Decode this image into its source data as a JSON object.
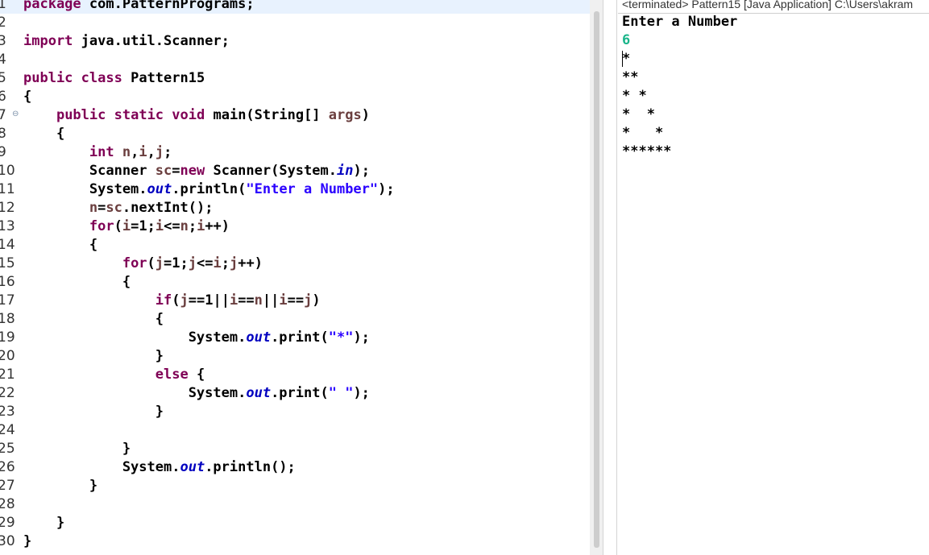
{
  "editor": {
    "lines": [
      {
        "num": "1",
        "tokens": [
          {
            "t": "package",
            "c": "kw"
          },
          {
            "t": " com.PatternPrograms;",
            "c": "pn"
          }
        ]
      },
      {
        "num": "2",
        "tokens": []
      },
      {
        "num": "3",
        "tokens": [
          {
            "t": "import",
            "c": "kw"
          },
          {
            "t": " java.util.Scanner;",
            "c": "pn"
          }
        ]
      },
      {
        "num": "4",
        "tokens": []
      },
      {
        "num": "5",
        "tokens": [
          {
            "t": "public",
            "c": "kw"
          },
          {
            "t": " ",
            "c": "pn"
          },
          {
            "t": "class",
            "c": "kw"
          },
          {
            "t": " Pattern15",
            "c": "pn"
          }
        ]
      },
      {
        "num": "6",
        "tokens": [
          {
            "t": "{",
            "c": "pn"
          }
        ]
      },
      {
        "num": "7",
        "fold": "⊖",
        "tokens": [
          {
            "t": "    ",
            "c": "pn"
          },
          {
            "t": "public",
            "c": "kw"
          },
          {
            "t": " ",
            "c": "pn"
          },
          {
            "t": "static",
            "c": "kw"
          },
          {
            "t": " ",
            "c": "pn"
          },
          {
            "t": "void",
            "c": "kw"
          },
          {
            "t": " main(String[] ",
            "c": "pn"
          },
          {
            "t": "args",
            "c": "var"
          },
          {
            "t": ")",
            "c": "pn"
          }
        ]
      },
      {
        "num": "8",
        "tokens": [
          {
            "t": "    {",
            "c": "pn"
          }
        ]
      },
      {
        "num": "9",
        "tokens": [
          {
            "t": "        ",
            "c": "pn"
          },
          {
            "t": "int",
            "c": "kw"
          },
          {
            "t": " ",
            "c": "pn"
          },
          {
            "t": "n",
            "c": "var"
          },
          {
            "t": ",",
            "c": "pn"
          },
          {
            "t": "i",
            "c": "var"
          },
          {
            "t": ",",
            "c": "pn"
          },
          {
            "t": "j",
            "c": "var"
          },
          {
            "t": ";",
            "c": "pn"
          }
        ]
      },
      {
        "num": "10",
        "tokens": [
          {
            "t": "        Scanner ",
            "c": "pn"
          },
          {
            "t": "sc",
            "c": "var"
          },
          {
            "t": "=",
            "c": "pn"
          },
          {
            "t": "new",
            "c": "kw"
          },
          {
            "t": " Scanner(System.",
            "c": "pn"
          },
          {
            "t": "in",
            "c": "fld"
          },
          {
            "t": ");",
            "c": "pn"
          }
        ]
      },
      {
        "num": "11",
        "tokens": [
          {
            "t": "        System.",
            "c": "pn"
          },
          {
            "t": "out",
            "c": "fld"
          },
          {
            "t": ".println(",
            "c": "pn"
          },
          {
            "t": "\"Enter a Number\"",
            "c": "str"
          },
          {
            "t": ");",
            "c": "pn"
          }
        ]
      },
      {
        "num": "12",
        "tokens": [
          {
            "t": "        ",
            "c": "pn"
          },
          {
            "t": "n",
            "c": "var"
          },
          {
            "t": "=",
            "c": "pn"
          },
          {
            "t": "sc",
            "c": "var"
          },
          {
            "t": ".nextInt();",
            "c": "pn"
          }
        ]
      },
      {
        "num": "13",
        "tokens": [
          {
            "t": "        ",
            "c": "pn"
          },
          {
            "t": "for",
            "c": "kw"
          },
          {
            "t": "(",
            "c": "pn"
          },
          {
            "t": "i",
            "c": "var"
          },
          {
            "t": "=1;",
            "c": "pn"
          },
          {
            "t": "i",
            "c": "var"
          },
          {
            "t": "<=",
            "c": "pn"
          },
          {
            "t": "n",
            "c": "var"
          },
          {
            "t": ";",
            "c": "pn"
          },
          {
            "t": "i",
            "c": "var"
          },
          {
            "t": "++)",
            "c": "pn"
          }
        ]
      },
      {
        "num": "14",
        "tokens": [
          {
            "t": "        {",
            "c": "pn"
          }
        ]
      },
      {
        "num": "15",
        "tokens": [
          {
            "t": "            ",
            "c": "pn"
          },
          {
            "t": "for",
            "c": "kw"
          },
          {
            "t": "(",
            "c": "pn"
          },
          {
            "t": "j",
            "c": "var"
          },
          {
            "t": "=1;",
            "c": "pn"
          },
          {
            "t": "j",
            "c": "var"
          },
          {
            "t": "<=",
            "c": "pn"
          },
          {
            "t": "i",
            "c": "var"
          },
          {
            "t": ";",
            "c": "pn"
          },
          {
            "t": "j",
            "c": "var"
          },
          {
            "t": "++)",
            "c": "pn"
          }
        ]
      },
      {
        "num": "16",
        "tokens": [
          {
            "t": "            {",
            "c": "pn"
          }
        ]
      },
      {
        "num": "17",
        "tokens": [
          {
            "t": "                ",
            "c": "pn"
          },
          {
            "t": "if",
            "c": "kw"
          },
          {
            "t": "(",
            "c": "pn"
          },
          {
            "t": "j",
            "c": "var"
          },
          {
            "t": "==1||",
            "c": "pn"
          },
          {
            "t": "i",
            "c": "var"
          },
          {
            "t": "==",
            "c": "pn"
          },
          {
            "t": "n",
            "c": "var"
          },
          {
            "t": "||",
            "c": "pn"
          },
          {
            "t": "i",
            "c": "var"
          },
          {
            "t": "==",
            "c": "pn"
          },
          {
            "t": "j",
            "c": "var"
          },
          {
            "t": ")",
            "c": "pn"
          }
        ]
      },
      {
        "num": "18",
        "tokens": [
          {
            "t": "                {",
            "c": "pn"
          }
        ]
      },
      {
        "num": "19",
        "tokens": [
          {
            "t": "                    System.",
            "c": "pn"
          },
          {
            "t": "out",
            "c": "fld"
          },
          {
            "t": ".print(",
            "c": "pn"
          },
          {
            "t": "\"*\"",
            "c": "str"
          },
          {
            "t": ");",
            "c": "pn"
          }
        ]
      },
      {
        "num": "20",
        "tokens": [
          {
            "t": "                }",
            "c": "pn"
          }
        ]
      },
      {
        "num": "21",
        "tokens": [
          {
            "t": "                ",
            "c": "pn"
          },
          {
            "t": "else",
            "c": "kw"
          },
          {
            "t": " {",
            "c": "pn"
          }
        ]
      },
      {
        "num": "22",
        "tokens": [
          {
            "t": "                    System.",
            "c": "pn"
          },
          {
            "t": "out",
            "c": "fld"
          },
          {
            "t": ".print(",
            "c": "pn"
          },
          {
            "t": "\" \"",
            "c": "str"
          },
          {
            "t": ");",
            "c": "pn"
          }
        ]
      },
      {
        "num": "23",
        "tokens": [
          {
            "t": "                }",
            "c": "pn"
          }
        ]
      },
      {
        "num": "24",
        "tokens": []
      },
      {
        "num": "25",
        "tokens": [
          {
            "t": "            }",
            "c": "pn"
          }
        ]
      },
      {
        "num": "26",
        "tokens": [
          {
            "t": "            System.",
            "c": "pn"
          },
          {
            "t": "out",
            "c": "fld"
          },
          {
            "t": ".println();",
            "c": "pn"
          }
        ]
      },
      {
        "num": "27",
        "tokens": [
          {
            "t": "        }",
            "c": "pn"
          }
        ]
      },
      {
        "num": "28",
        "tokens": []
      },
      {
        "num": "29",
        "tokens": [
          {
            "t": "    }",
            "c": "pn"
          }
        ]
      },
      {
        "num": "30",
        "tokens": [
          {
            "t": "}",
            "c": "pn"
          }
        ]
      }
    ]
  },
  "console": {
    "header": "<terminated> Pattern15 [Java Application] C:\\Users\\akram",
    "lines": [
      {
        "text": "Enter a Number",
        "type": "output"
      },
      {
        "text": "6",
        "type": "input"
      },
      {
        "text": "*",
        "type": "output"
      },
      {
        "text": "**",
        "type": "output"
      },
      {
        "text": "* *",
        "type": "output"
      },
      {
        "text": "*  *",
        "type": "output"
      },
      {
        "text": "*   *",
        "type": "output"
      },
      {
        "text": "******",
        "type": "output"
      }
    ]
  },
  "colors": {
    "keyword": "#7f0055",
    "local_variable": "#6a3e3e",
    "static_field": "#0000c0",
    "string": "#2a00ff",
    "console_input": "#1ab58a",
    "current_line": "#e8f2fe"
  }
}
